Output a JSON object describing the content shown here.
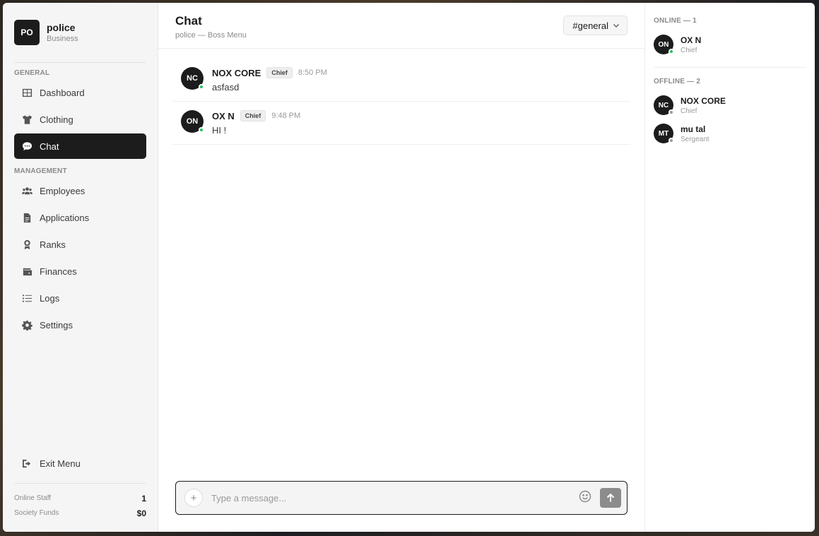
{
  "brand": {
    "logo": "PO",
    "name": "police",
    "subtitle": "Business"
  },
  "sidebar": {
    "general_label": "GENERAL",
    "general_items": [
      {
        "label": "Dashboard",
        "icon": "dashboard-icon"
      },
      {
        "label": "Clothing",
        "icon": "shirt-icon"
      },
      {
        "label": "Chat",
        "icon": "chat-icon",
        "active": true
      }
    ],
    "management_label": "MANAGEMENT",
    "management_items": [
      {
        "label": "Employees",
        "icon": "users-icon"
      },
      {
        "label": "Applications",
        "icon": "document-icon"
      },
      {
        "label": "Ranks",
        "icon": "award-icon"
      },
      {
        "label": "Finances",
        "icon": "wallet-icon"
      },
      {
        "label": "Logs",
        "icon": "list-icon"
      },
      {
        "label": "Settings",
        "icon": "gear-icon"
      }
    ],
    "exit_label": "Exit Menu",
    "stats": [
      {
        "label": "Online Staff",
        "value": "1"
      },
      {
        "label": "Society Funds",
        "value": "$0"
      }
    ]
  },
  "header": {
    "title": "Chat",
    "subtitle": "police — Boss Menu",
    "channel": "#general"
  },
  "messages": [
    {
      "initials": "NC",
      "author": "NOX CORE",
      "role": "Chief",
      "time": "8:50 PM",
      "text": "asfasd"
    },
    {
      "initials": "ON",
      "author": "OX N",
      "role": "Chief",
      "time": "9:48 PM",
      "text": "HI !"
    }
  ],
  "composer": {
    "placeholder": "Type a message..."
  },
  "members": {
    "online_label": "ONLINE — 1",
    "online": [
      {
        "initials": "ON",
        "name": "OX N",
        "role": "Chief"
      }
    ],
    "offline_label": "OFFLINE — 2",
    "offline": [
      {
        "initials": "NC",
        "name": "NOX CORE",
        "role": "Chief"
      },
      {
        "initials": "MT",
        "name": "mu tal",
        "role": "Sergeant"
      }
    ]
  },
  "colors": {
    "accent": "#1c1c1c",
    "online": "#22c55e",
    "offline": "#9a9a9a",
    "sidebar_bg": "#f5f5f5"
  }
}
